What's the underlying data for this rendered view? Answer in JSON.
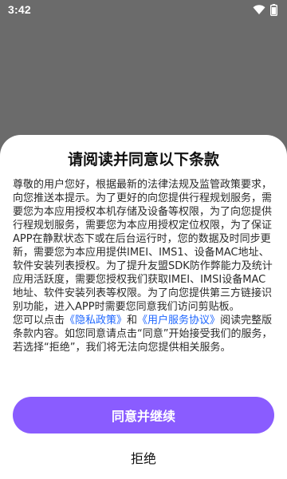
{
  "status_bar": {
    "time": "3:42",
    "icons": [
      "wifi-icon",
      "battery-icon"
    ]
  },
  "dialog": {
    "title": "请阅读并同意以下条款",
    "paragraphs": {
      "p1": "尊敬的用户您好，根据最新的法律法规及监管政策要求，向您推送本提示。为了更好的向您提供行程规划服务，需要您为本应用授权本机存储及设备等权限，为了向您提供行程规划服务，需要您为本应用授权定位权限，为了保证APP在静默状态下或在后台运行时，您的数据及时同步更新，需要您为本应用提供IMEI、IMS1、设备MAC地址、软件安装列表授权。为了提升友盟SDK防作弊能力及统计应用活跃度，需要您授权我们获取IMEI、IMSI设备MAC地址、软件安装列表等权限。为了向您提供第三方链接识别功能，进入APP时需要您同意我们访问剪贴板。",
      "p2_prefix": "您可以点击",
      "privacy_link": "《隐私政策》",
      "p2_and": "和",
      "service_link": "《用户服务协议》",
      "p2_suffix": "阅读完整版条款内容。如您同意请点击“同意”开始接受我们的服务，若选择“拒绝”，我们将无法向您提供相关服务。"
    },
    "agree_button": "同意并继续",
    "reject_button": "拒绝"
  },
  "colors": {
    "backdrop": "#6b6b6b",
    "accent_button": "#8a5cff",
    "link": "#1f67ff"
  }
}
